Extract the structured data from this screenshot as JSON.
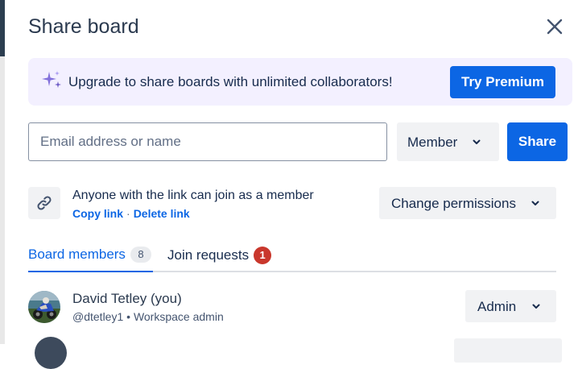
{
  "dialog": {
    "title": "Share board",
    "close_icon": "close-icon"
  },
  "banner": {
    "icon": "sparkle-icon",
    "text": "Upgrade to share boards with unlimited collaborators!",
    "cta_label": "Try Premium"
  },
  "invite": {
    "email_placeholder": "Email address or name",
    "email_value": "",
    "role_value": "Member",
    "share_label": "Share"
  },
  "link": {
    "icon": "link-icon",
    "description": "Anyone with the link can join as a member",
    "copy_label": "Copy link",
    "separator": "·",
    "delete_label": "Delete link",
    "permissions_label": "Change permissions"
  },
  "tabs": [
    {
      "label": "Board members",
      "count": "8",
      "active": true
    },
    {
      "label": "Join requests",
      "count": "1",
      "active": false
    }
  ],
  "members": [
    {
      "name": "David Tetley (you)",
      "handle": "@dtetley1",
      "bullet": "•",
      "role_desc": "Workspace admin",
      "role": "Admin"
    }
  ],
  "colors": {
    "primary": "#0c66e4",
    "banner_bg": "#f3f0ff",
    "button_bg": "#f1f2f4",
    "badge_red": "#c9372c",
    "text": "#172b4d"
  }
}
